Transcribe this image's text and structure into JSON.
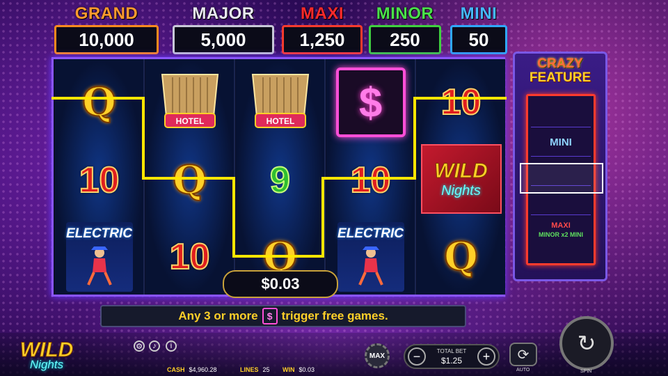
{
  "jackpots": [
    {
      "name": "GRAND",
      "value": "10,000",
      "color": "#ff9a2e",
      "border": "#ff8a1e"
    },
    {
      "name": "MAJOR",
      "value": "5,000",
      "color": "#e8e8f0",
      "border": "#c8c8d8"
    },
    {
      "name": "MAXI",
      "value": "1,250",
      "color": "#ff2a2a",
      "border": "#ff3b2d"
    },
    {
      "name": "MINOR",
      "value": "250",
      "color": "#4ae04a",
      "border": "#3fd13f"
    },
    {
      "name": "MINI",
      "value": "50",
      "color": "#46b8ff",
      "border": "#2fa8ff"
    }
  ],
  "reels": [
    [
      "Q",
      "10",
      "ELECTRIC"
    ],
    [
      "HOTEL",
      "Q",
      "10"
    ],
    [
      "HOTEL",
      "9",
      "Q"
    ],
    [
      "$",
      "10",
      "ELECTRIC"
    ],
    [
      "10",
      "WILD Nights",
      "Q"
    ]
  ],
  "symbols": {
    "hotel": "HOTEL",
    "electric": "ELECTRIC",
    "wild_top": "WILD",
    "wild_bottom": "Nights",
    "dollar": "$"
  },
  "win_amount": "$0.03",
  "crazy_feature": {
    "title1": "CRAZY",
    "title2": "FEATURE",
    "wheel": [
      "MINI",
      "MAXI",
      "MINOR x2 MINI"
    ]
  },
  "message": {
    "before": "Any 3 or more",
    "icon": "$",
    "after": "trigger free games."
  },
  "logo": {
    "line1": "WILD",
    "line2": "Nights"
  },
  "stats": {
    "cash_label": "CASH",
    "cash": "$4,960.28",
    "lines_label": "LINES",
    "lines": "25",
    "win_label": "WIN",
    "win": "$0.03"
  },
  "controls": {
    "max_label": "MAX",
    "total_bet_label": "TOTAL BET",
    "total_bet": "$1.25",
    "minus": "−",
    "plus": "+",
    "auto_label": "AUTO",
    "spin_label": "SPIN"
  },
  "payline_color": "#ffe600"
}
